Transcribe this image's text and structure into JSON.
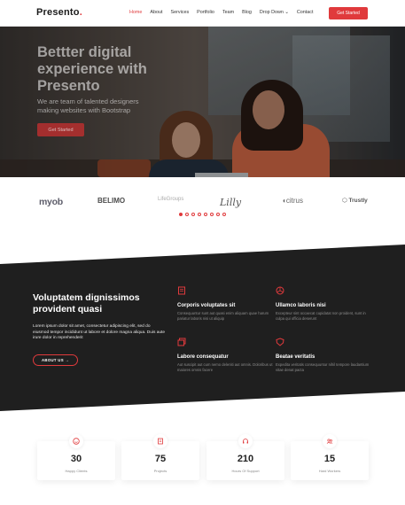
{
  "nav": {
    "logo": "Presento",
    "logo_dot": ".",
    "items": [
      {
        "label": "Home",
        "active": true
      },
      {
        "label": "About"
      },
      {
        "label": "Services"
      },
      {
        "label": "Portfolio"
      },
      {
        "label": "Team"
      },
      {
        "label": "Blog"
      },
      {
        "label": "Drop Down ⌄"
      },
      {
        "label": "Contact"
      }
    ],
    "cta": "Get Started"
  },
  "hero": {
    "title": "Bettter digital experience with Presento",
    "subtitle": "We are team of talented designers making websites with Bootstrap",
    "button": "Get Started"
  },
  "clients": {
    "logos": [
      "myob",
      "BELIMO",
      "LifeGroups",
      "Lilly",
      "citrus",
      "Trustly"
    ],
    "carousel_pages": 8,
    "carousel_active": 0
  },
  "about": {
    "title": "Voluptatem dignissimos provident quasi",
    "text": "Lorem ipsum dolor sit amet, consectetur adipiscing elit, sed do eiusmod tempor incididunt ut labore et dolore magna aliqua. Duis aute irure dolor in reprehenderit",
    "button": "ABOUT US →",
    "features": [
      {
        "icon": "receipt-icon",
        "title": "Corporis voluptates sit",
        "text": "Consequuntur sunt aut quasi enim aliquam quae harum pariatur laboris nisi ut aliquip"
      },
      {
        "icon": "cube-icon",
        "title": "Ullamco laboris nisi",
        "text": "Excepteur sint occaecat cupidatat non proident, sunt in culpa qui officia deserunt"
      },
      {
        "icon": "images-icon",
        "title": "Labore consequatur",
        "text": "Aut suscipit aut cum nemo deleniti aut omnis. Doloribus ut maiores omnis facere"
      },
      {
        "icon": "shield-icon",
        "title": "Beatae veritatis",
        "text": "Expedita veritatis consequuntur nihil tempore laudantium vitae denat pacta"
      }
    ]
  },
  "counts": [
    {
      "icon": "smile-icon",
      "value": "30",
      "label": "Happy Clients"
    },
    {
      "icon": "journal-icon",
      "value": "75",
      "label": "Projects"
    },
    {
      "icon": "headset-icon",
      "value": "210",
      "label": "Hours Of Support"
    },
    {
      "icon": "people-icon",
      "value": "15",
      "label": "Hard Workers"
    }
  ],
  "colors": {
    "accent": "#e03a3c",
    "dark": "#1f1f1f"
  }
}
